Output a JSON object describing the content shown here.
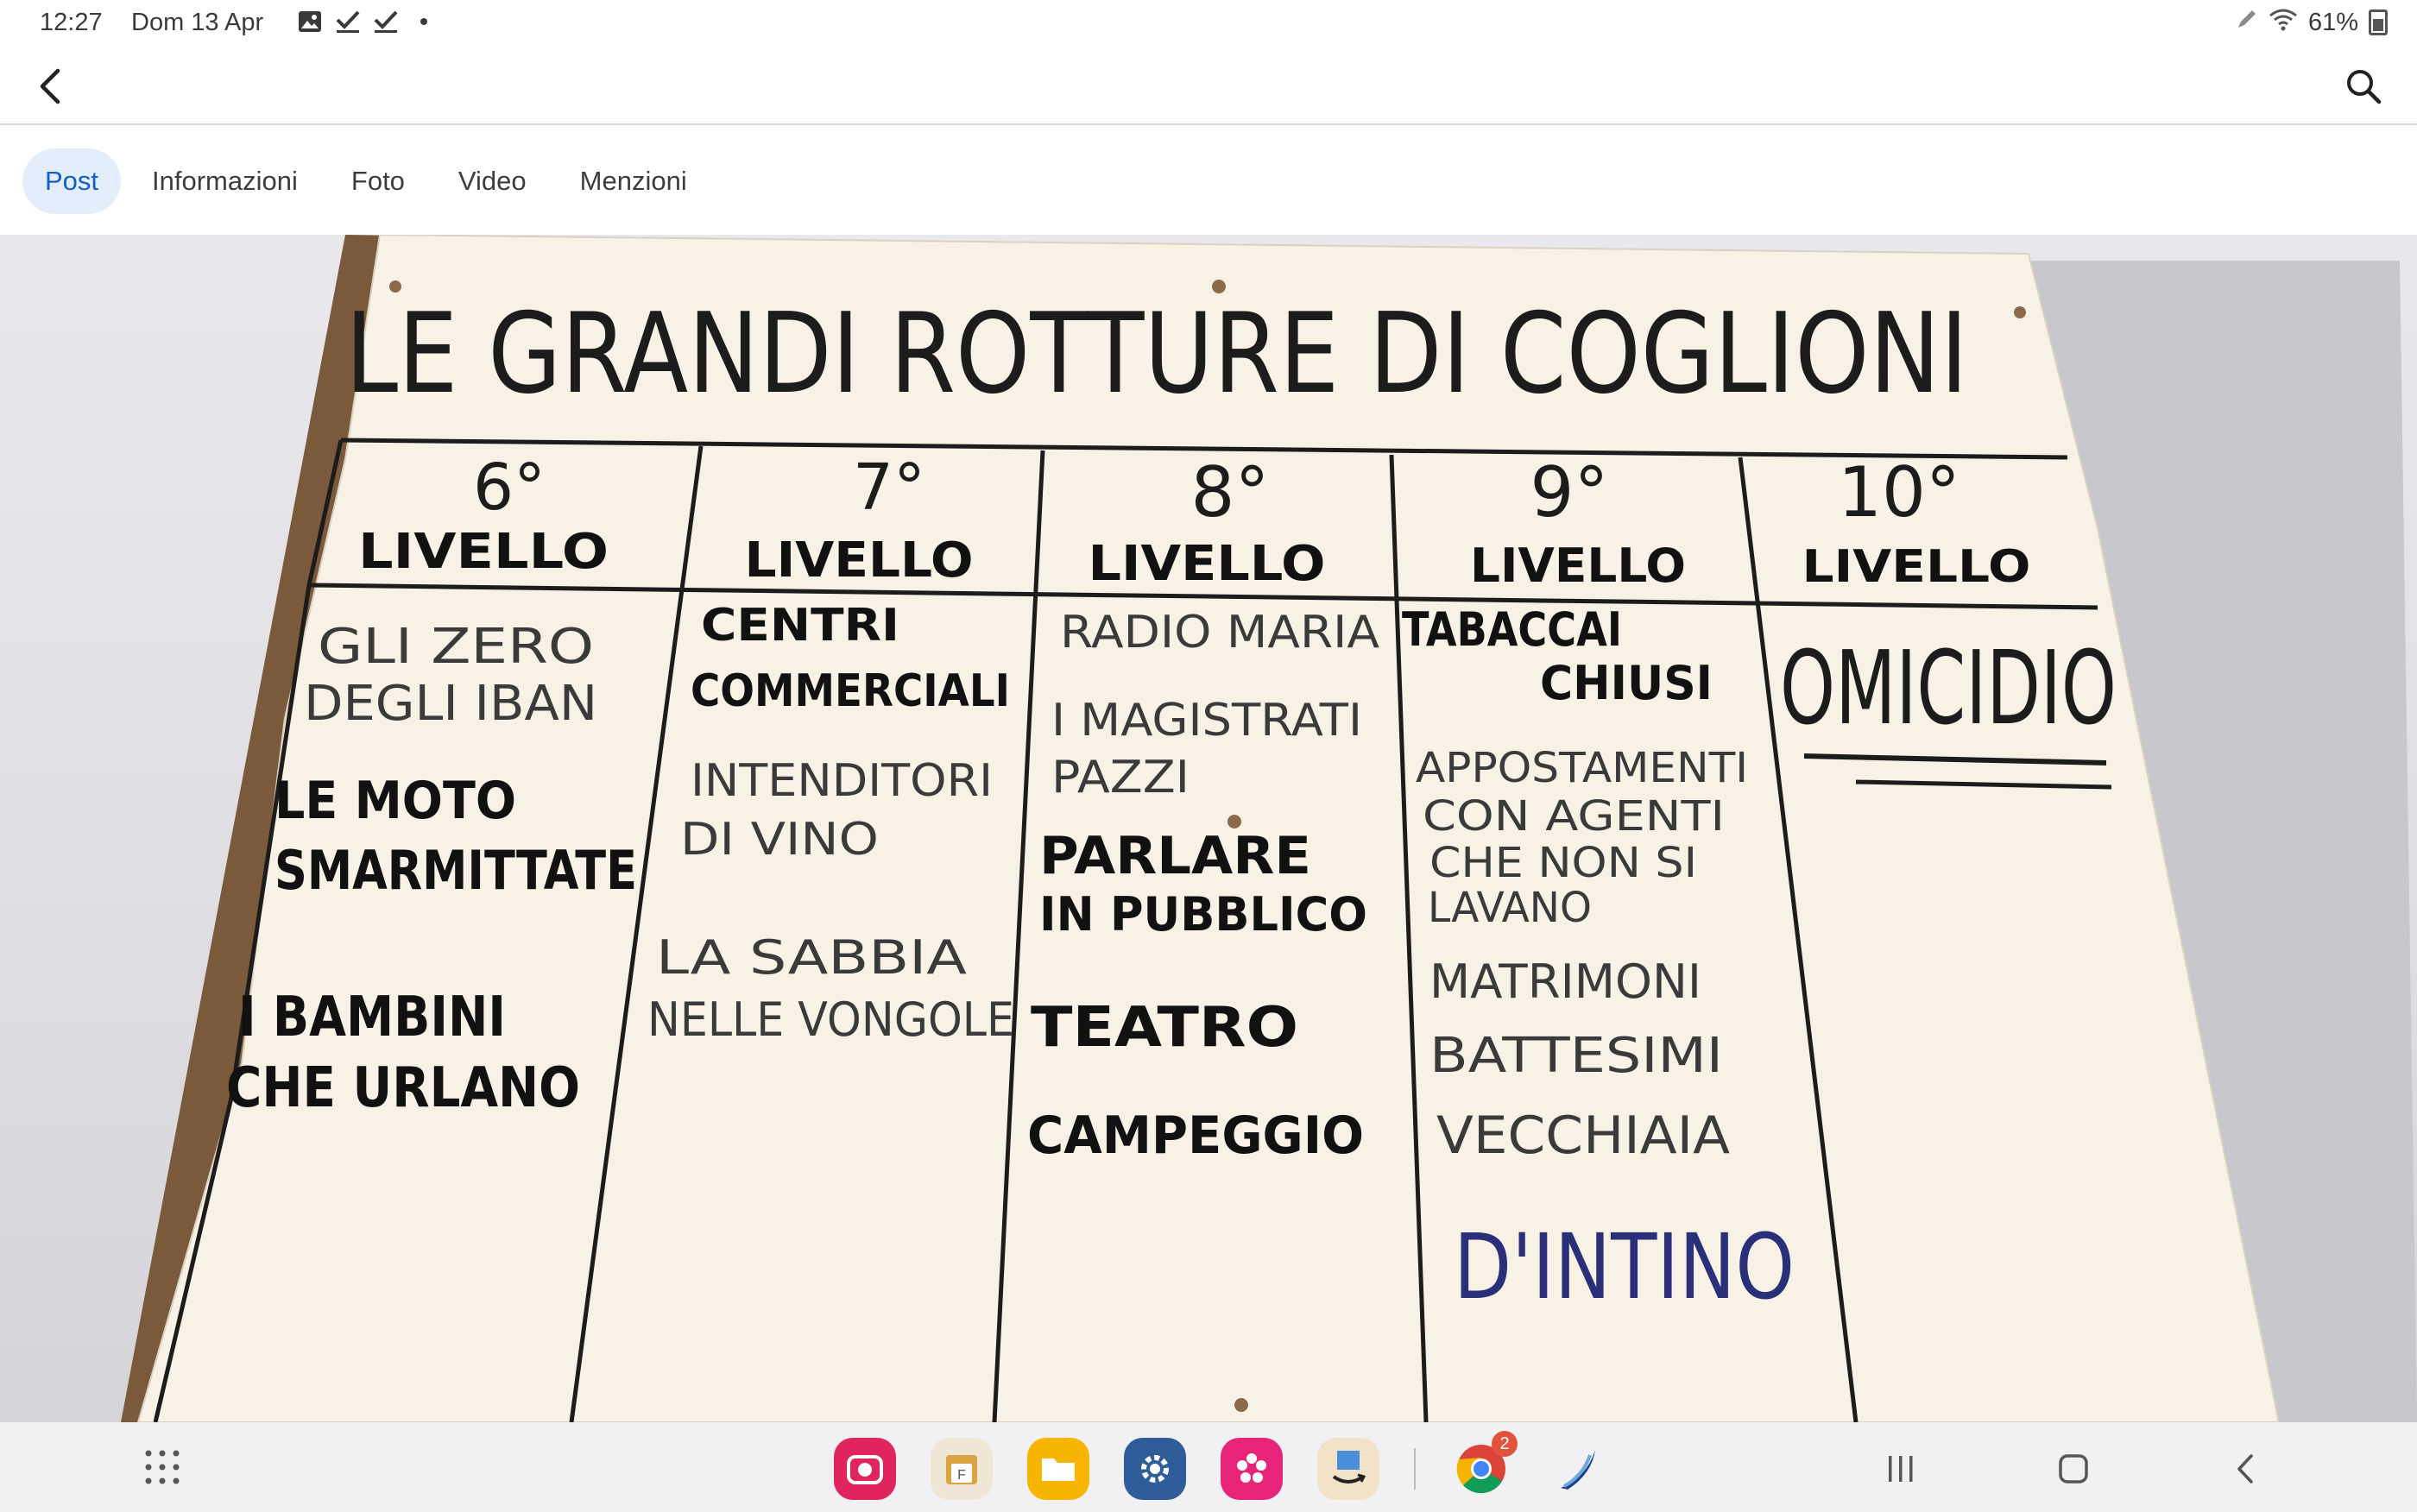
{
  "status_bar": {
    "time": "12:27",
    "date": "Dom 13 Apr",
    "left_icons": [
      "image-icon",
      "check-icon",
      "check-icon",
      "dot-icon"
    ],
    "battery": "61%",
    "right_icons": [
      "pen-icon",
      "wifi-icon",
      "battery-icon"
    ]
  },
  "app_bar": {
    "back_icon": "chevron-left-icon",
    "search_icon": "search-icon"
  },
  "tabs": [
    {
      "label": "Post",
      "active": true
    },
    {
      "label": "Informazioni",
      "active": false
    },
    {
      "label": "Foto",
      "active": false
    },
    {
      "label": "Video",
      "active": false
    },
    {
      "label": "Menzioni",
      "active": false
    }
  ],
  "photo": {
    "title": "LE GRANDI ROTTURE DI COGLIONI",
    "columns": [
      {
        "number": "6°",
        "level": "LIVELLO",
        "items": [
          "GLI ZERO",
          "DEGLI IBAN",
          "LE MOTO",
          "SMARMITTATE",
          "I BAMBINI",
          "CHE URLANO"
        ]
      },
      {
        "number": "7°",
        "level": "LIVELLO",
        "items": [
          "CENTRI",
          "COMMERCIALI",
          "INTENDITORI",
          "DI VINO",
          "LA SABBIA",
          "NELLE VONGOLE"
        ]
      },
      {
        "number": "8°",
        "level": "LIVELLO",
        "items": [
          "RADIO MARIA",
          "I MAGISTRATI",
          "PAZZI",
          "PARLARE",
          "IN PUBBLICO",
          "TEATRO",
          "CAMPEGGIO"
        ]
      },
      {
        "number": "9°",
        "level": "LIVELLO",
        "items": [
          "TABACCAI",
          "CHIUSI",
          "APPOSTAMENTI",
          "CON AGENTI",
          "CHE NON SI",
          "LAVANO",
          "MATRIMONI",
          "BATTESIMI",
          "VECCHIAIA",
          "D'INTINO"
        ]
      },
      {
        "number": "10°",
        "level": "LIVELLO",
        "items": [
          "OMICIDIO"
        ]
      }
    ]
  },
  "nav_bar": {
    "apps_icon": "apps-grid-icon",
    "dock": [
      {
        "name": "camera-app-icon",
        "color": "#e0245e"
      },
      {
        "name": "file-manager-icon",
        "color": "#d9a441"
      },
      {
        "name": "folder-icon",
        "color": "#f7b500"
      },
      {
        "name": "settings-icon",
        "color": "#2f5d9a"
      },
      {
        "name": "gallery-icon",
        "color": "#e8247a"
      },
      {
        "name": "amazon-icon",
        "color": "#f3a847"
      },
      {
        "name": "chrome-icon",
        "color": "#4285f4",
        "badge": "2"
      },
      {
        "name": "swift-app-icon",
        "color": "#1b3f8f"
      }
    ],
    "recents_icon": "recents-icon",
    "home_icon": "home-icon",
    "back_icon": "back-nav-icon"
  }
}
